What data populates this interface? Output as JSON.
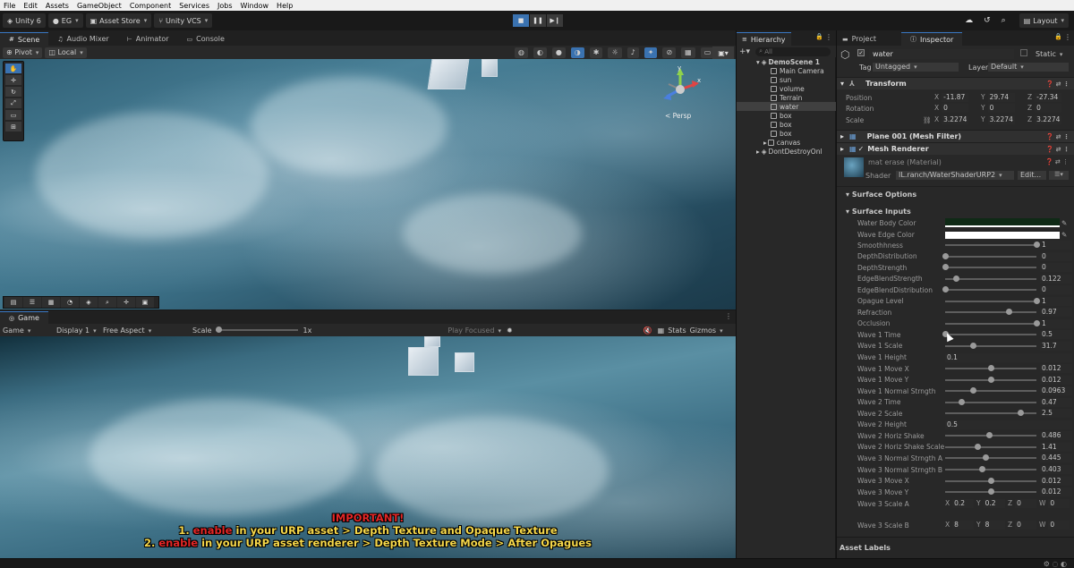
{
  "menubar": [
    "File",
    "Edit",
    "Assets",
    "GameObject",
    "Component",
    "Services",
    "Jobs",
    "Window",
    "Help"
  ],
  "toolbar": {
    "app": "Unity 6",
    "account": "EG",
    "asset_store": "Asset Store",
    "vcs": "Unity VCS",
    "layout": "Layout"
  },
  "scene_tabs": [
    "Scene",
    "Audio Mixer",
    "Animator",
    "Console"
  ],
  "scene_toolbar": {
    "pivot": "Pivot",
    "local": "Local"
  },
  "gizmo": {
    "axis_y": "y",
    "axis_x": "x",
    "projection": "< Persp"
  },
  "game_tab": "Game",
  "game_toolbar": {
    "mode": "Game",
    "display": "Display 1",
    "aspect": "Free Aspect",
    "scale_label": "Scale",
    "scale_value": "1x",
    "play_focused": "Play Focused",
    "stats": "Stats",
    "gizmos": "Gizmos"
  },
  "notice": {
    "title": "IMPORTANT!",
    "line1_num": "1.",
    "line1_red": "enable",
    "line1_rest": "in your URP asset > Depth Texture and Opaque Texture",
    "line2_num": "2.",
    "line2_red": "enable",
    "line2_rest": "in your URP asset renderer > Depth Texture Mode > After Opagues"
  },
  "hierarchy": {
    "tab": "Hierarchy",
    "search_placeholder": "All",
    "scene": "DemoScene 1",
    "items": [
      "Main Camera",
      "sun",
      "volume",
      "Terrain",
      "water",
      "box",
      "box",
      "box",
      "canvas"
    ],
    "dontdestroy": "DontDestroyOnl"
  },
  "inspector": {
    "tabs": [
      "Project",
      "Inspector"
    ],
    "object_name": "water",
    "static": "Static",
    "tag_label": "Tag",
    "tag": "Untagged",
    "layer_label": "Layer",
    "layer": "Default",
    "transform": {
      "title": "Transform",
      "position": {
        "label": "Position",
        "x": "-11.87",
        "y": "29.74",
        "z": "-27.34"
      },
      "rotation": {
        "label": "Rotation",
        "x": "0",
        "y": "0",
        "z": "0"
      },
      "scale": {
        "label": "Scale",
        "x": "3.2274",
        "y": "3.2274",
        "z": "3.2274"
      }
    },
    "mesh_filter": "Plane 001 (Mesh Filter)",
    "mesh_renderer": "Mesh Renderer",
    "material": {
      "name": "mat erase (Material)",
      "shader_label": "Shader",
      "shader": "IL.ranch/WaterShaderURP2",
      "edit": "Edit..."
    },
    "surface_options": "Surface Options",
    "surface_inputs": "Surface Inputs",
    "colors": [
      {
        "label": "Water Body Color",
        "color": "#0f2a16"
      },
      {
        "label": "Wave Edge Color",
        "color": "#ffffff"
      }
    ],
    "sliders": [
      {
        "label": "Smoothhness",
        "value": "1",
        "pos": 1
      },
      {
        "label": "DepthDistribution",
        "value": "0",
        "pos": 0
      },
      {
        "label": "DepthStrength",
        "value": "0",
        "pos": 0
      },
      {
        "label": "EdgeBlendStrength",
        "value": "0.122",
        "pos": 0.122
      },
      {
        "label": "EdgeBlendDistribution",
        "value": "0",
        "pos": 0
      },
      {
        "label": "Opague Level",
        "value": "1",
        "pos": 1
      },
      {
        "label": "Refraction",
        "value": "0.97",
        "pos": 0.7
      },
      {
        "label": "Occlusion",
        "value": "1",
        "pos": 1
      },
      {
        "label": "Wave 1 Time",
        "value": "0.5",
        "pos": 0
      },
      {
        "label": "Wave 1 Scale",
        "value": "31.7",
        "pos": 0.3
      },
      {
        "label": "Wave 1 Height",
        "value": "0.1",
        "pos": null
      },
      {
        "label": "Wave 1 Move X",
        "value": "0.012",
        "pos": 0.5
      },
      {
        "label": "Wave 1 Move Y",
        "value": "0.012",
        "pos": 0.5
      },
      {
        "label": "Wave 1 Normal Strngth",
        "value": "0.0963",
        "pos": 0.3
      },
      {
        "label": "Wave 2 Time",
        "value": "0.47",
        "pos": 0.18
      },
      {
        "label": "Wave 2 Scale",
        "value": "2.5",
        "pos": 0.82
      },
      {
        "label": "Wave 2 Height",
        "value": "0.5",
        "pos": null
      },
      {
        "label": "Wave 2 Horiz Shake",
        "value": "0.486",
        "pos": 0.48
      },
      {
        "label": "Wave 2 Horiz Shake Scale",
        "value": "1.41",
        "pos": 0.35
      },
      {
        "label": "Wave 3 Normal Strngth A",
        "value": "0.445",
        "pos": 0.44
      },
      {
        "label": "Wave 3 Normal Strngth B",
        "value": "0.403",
        "pos": 0.4
      },
      {
        "label": "Wave 3 Move X",
        "value": "0.012",
        "pos": 0.5
      },
      {
        "label": "Wave 3 Move Y",
        "value": "0.012",
        "pos": 0.5
      }
    ],
    "wave3_scale_a": {
      "label": "Wave 3 Scale A",
      "x": "0.2",
      "y": "0.2",
      "z": "0",
      "w": "0"
    },
    "wave3_scale_b": {
      "label": "Wave 3 Scale B",
      "x": "8",
      "y": "8",
      "z": "0",
      "w": "0"
    },
    "asset_labels": "Asset Labels"
  }
}
